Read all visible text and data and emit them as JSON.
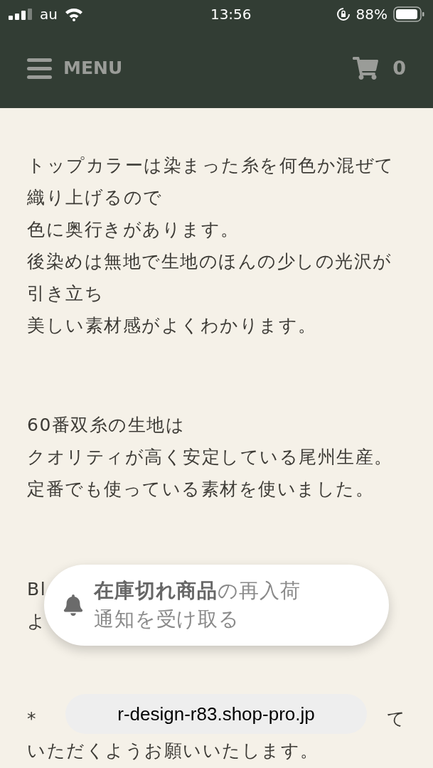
{
  "status_bar": {
    "carrier": "au",
    "time": "13:56",
    "battery": "88%"
  },
  "nav": {
    "menu_label": "MENU",
    "cart_count": "0"
  },
  "paragraphs": [
    {
      "lines": [
        "トップカラーは染まった糸を何色か混ぜて織り上げるので",
        "色に奥行きがあります。",
        "後染めは無地で生地のほんの少しの光沢が引き立ち",
        "美しい素材感がよくわかります。"
      ]
    },
    {
      "lines": [
        "60番双糸の生地は",
        "クオリティが高く安定している尾州生産。",
        "定番でも使っている素材を使いました。"
      ]
    },
    {
      "lines": [
        "Bl",
        "よ"
      ]
    },
    {
      "lines": [
        [
          "*",
          "て"
        ],
        "いただくようお願いいたします。"
      ]
    }
  ],
  "restock_popup": {
    "lines": [
      "**在庫切れ商品**の再入荷",
      "通知を受け取る"
    ]
  },
  "url_bar": {
    "address": "r-design-r83.shop-pro.jp"
  }
}
